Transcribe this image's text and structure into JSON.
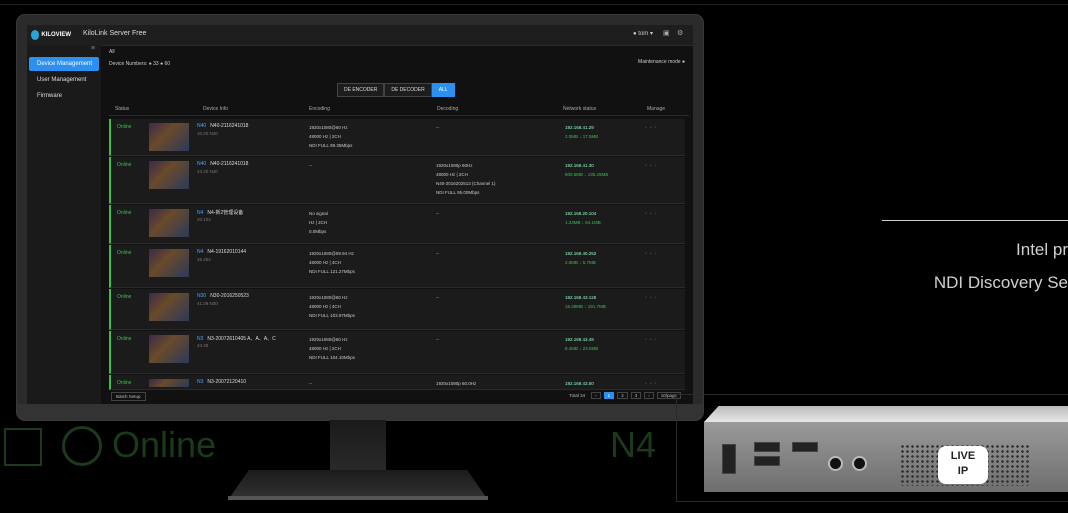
{
  "background": {
    "large_status": "Online",
    "large_device": "N4",
    "tagline_1": "Intel pr",
    "tagline_2": "NDI Discovery Se"
  },
  "app": {
    "brand": "KILOVIEW",
    "title": "KiloLink Server Free",
    "user": "tom",
    "sidebar": [
      "Device Management",
      "User Management",
      "Firmware"
    ],
    "breadcrumb": "All",
    "device_numbers": "Device Numbers: ● 33  ● 60",
    "maintenance": "Maintenance mode",
    "tabs": [
      "DE ENCODER",
      "DE DECODER",
      "ALL"
    ],
    "columns": [
      "Status",
      "Device Info",
      "Encoding",
      "Decoding",
      "Network status",
      "Manage"
    ],
    "rows": [
      {
        "status": "Online",
        "name": "N40",
        "id": "N40-2116241018",
        "ip": "10.20.N40",
        "enc": [
          "1920x1080@60 Hz",
          "48000 Hz  |  2CH",
          "NDI FULL  99.35Mbps"
        ],
        "dec": [
          "--"
        ],
        "net": [
          "192.168.41.29",
          "2.0MB  ↓  17.5MB"
        ]
      },
      {
        "status": "Online",
        "name": "N40",
        "id": "N40-2116241018",
        "ip": "43.20 N40",
        "enc": [
          "--"
        ],
        "dec": [
          "1920x1080p 60Hz",
          "48000 Hz  |  2CH",
          "N40-2016202513 (Channel 1)",
          "NDI FULL  95.00Mbps"
        ],
        "net": [
          "192.168.41.30",
          "600.6MB  ↓  135.25MB"
        ]
      },
      {
        "status": "Online",
        "name": "N4",
        "id": "N4-新2管理设备",
        "ip": "20.104",
        "enc": [
          "No signal",
          "Hz  |  2CH",
          "0.0Mbps"
        ],
        "dec": [
          "--"
        ],
        "net": [
          "192.168.20.104",
          "1.23MB  ↓  64.1MB"
        ]
      },
      {
        "status": "Online",
        "name": "N4",
        "id": "N4-19162010144",
        "ip": "46.252",
        "enc": [
          "1920x1080@59.94 Hz",
          "48000 Hz  |  4CH",
          "NDI FULL  121.27Mbps"
        ],
        "dec": [
          "--"
        ],
        "net": [
          "192.168.40.252",
          "2.0MB  ↓  5.7MB"
        ]
      },
      {
        "status": "Online",
        "name": "N30",
        "id": "N30-2016250523",
        "ip": "41.28 N30",
        "enc": [
          "1920x1080@60 Hz",
          "48000 Hz  |  4CH",
          "NDI FULL  103.97Mbps"
        ],
        "dec": [
          "--"
        ],
        "net": [
          "192.168.43.126",
          "16.29MB  ↓  191.7MB"
        ]
      },
      {
        "status": "Online",
        "name": "N3",
        "id": "N3-20072610405 A、A、A、C",
        "ip": "43.49",
        "enc": [
          "1920x1080@60 Hz",
          "48000 Hz  |  2CH",
          "NDI FULL  104.10Mbps"
        ],
        "dec": [
          "--"
        ],
        "net": [
          "192.168.43.49",
          "8.4MB  ↓  23.5MB"
        ]
      },
      {
        "status": "Online",
        "name": "N3",
        "id": "N3-20072120410",
        "ip": "",
        "enc": [
          "--"
        ],
        "dec": [
          "1920x1080p 60.0Hz"
        ],
        "net": [
          "192.168.43.50",
          ""
        ]
      }
    ],
    "batch": "Batch Setup",
    "total": "Total 34",
    "pages": [
      "1",
      "2",
      "3"
    ],
    "per_page": "10/page"
  },
  "device": {
    "badge_line1": "LIVE",
    "badge_line2": "IP"
  }
}
